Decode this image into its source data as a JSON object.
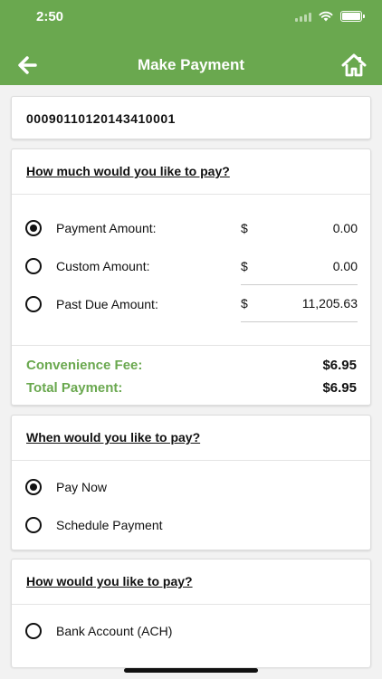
{
  "status_bar": {
    "time": "2:50"
  },
  "header": {
    "title": "Make Payment",
    "back_icon": "arrow-left-icon",
    "home_icon": "home-icon"
  },
  "account": {
    "number": "00090110120143410001"
  },
  "amount_section": {
    "title": "How much would you like to pay?",
    "options": [
      {
        "label": "Payment Amount:",
        "currency": "$",
        "value": "0.00",
        "selected": true
      },
      {
        "label": "Custom Amount:",
        "currency": "$",
        "value": "0.00",
        "selected": false
      },
      {
        "label": "Past Due Amount:",
        "currency": "$",
        "value": "11,205.63",
        "selected": false
      }
    ],
    "convenience_fee_label": "Convenience Fee:",
    "convenience_fee_value": "$6.95",
    "total_label": "Total Payment:",
    "total_value": "$6.95"
  },
  "when_section": {
    "title": "When would you like to pay?",
    "options": [
      {
        "label": "Pay Now",
        "selected": true
      },
      {
        "label": "Schedule Payment",
        "selected": false
      }
    ]
  },
  "how_section": {
    "title": "How would you like to pay?",
    "options": [
      {
        "label": "Bank Account (ACH)",
        "selected": false
      }
    ]
  },
  "colors": {
    "brand_green": "#6aa84f",
    "text": "#111111",
    "background": "#f2f2f2"
  }
}
